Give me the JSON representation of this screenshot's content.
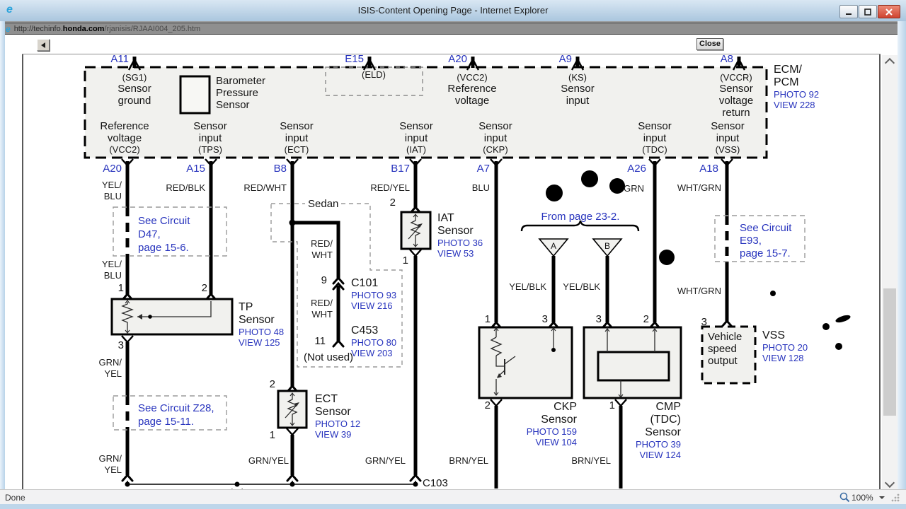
{
  "window": {
    "title": "ISIS-Content Opening Page - Internet Explorer",
    "url_prefix": "http://techinfo.",
    "url_domain": "honda.com",
    "url_path": "/rjanisis/RJAAI004_205.htm",
    "close_button": "Close",
    "status": "Done",
    "zoom_level": "100%"
  },
  "colors": {
    "link_blue": "#2733bd",
    "wire_black": "#000000",
    "titlebar_blue": "#c8dbec",
    "close_red": "#d9482f"
  },
  "ecm": {
    "name": [
      "ECM/",
      "PCM"
    ],
    "photo": "PHOTO 92",
    "view": "VIEW 228",
    "eld": "(ELD)",
    "top_pins": [
      "A11",
      "E15",
      "A20",
      "A9",
      "A8"
    ],
    "bottom_pins": [
      "A20",
      "A15",
      "B8",
      "B17",
      "A7",
      "A26",
      "A18"
    ],
    "cells": {
      "sg1": [
        "(SG1)",
        "Sensor",
        "ground"
      ],
      "baro": [
        "Barometer",
        "Pressure",
        "Sensor"
      ],
      "vcc2_top": [
        "(VCC2)",
        "Reference",
        "voltage"
      ],
      "ks": [
        "(KS)",
        "Sensor",
        "input"
      ],
      "vccr": [
        "(VCCR)",
        "Sensor",
        "voltage",
        "return"
      ],
      "refv": [
        "Reference",
        "voltage",
        "(VCC2)"
      ],
      "tps": [
        "Sensor",
        "input",
        "(TPS)"
      ],
      "ect": [
        "Sensor",
        "input",
        "(ECT)"
      ],
      "iat": [
        "Sensor",
        "input",
        "(IAT)"
      ],
      "ckp": [
        "Sensor",
        "input",
        "(CKP)"
      ],
      "tdc": [
        "Sensor",
        "input",
        "(TDC)"
      ],
      "vss": [
        "Sensor",
        "input",
        "(VSS)"
      ]
    }
  },
  "wire_labels": {
    "yel_blu": [
      "YEL/",
      "BLU"
    ],
    "red_blk": "RED/BLK",
    "red_wht": "RED/WHT",
    "red_yel": "RED/YEL",
    "blu": "BLU",
    "grn": "GRN",
    "wht_grn": "WHT/GRN",
    "grn_yel_stacked": [
      "GRN/",
      "YEL"
    ],
    "grn_yel": "GRN/YEL",
    "brn_yel": "BRN/YEL",
    "yel_blk": "YEL/BLK",
    "red_wht_stacked": [
      "RED/",
      "WHT"
    ]
  },
  "refs": {
    "d47": [
      "See Circuit",
      "D47,",
      "page 15-6."
    ],
    "z28": [
      "See Circuit Z28,",
      "page 15-11."
    ],
    "e93": [
      "See Circuit",
      "E93,",
      "page 15-7."
    ],
    "from_page": "From page 23-2.",
    "sedan": "Sedan",
    "not_used": "(Not used)",
    "c103": "C103"
  },
  "connectors": {
    "c101": {
      "pin": "9",
      "name": "C101",
      "photo": "PHOTO 93",
      "view": "VIEW 216"
    },
    "c453": {
      "pin": "11",
      "name": "C453",
      "photo": "PHOTO 80",
      "view": "VIEW 203"
    }
  },
  "sensors": {
    "tp": {
      "name": [
        "TP",
        "Sensor"
      ],
      "photo": "PHOTO 48",
      "view": "VIEW 125",
      "pin1": "1",
      "pin2": "2",
      "pin3": "3"
    },
    "ect": {
      "name": [
        "ECT",
        "Sensor"
      ],
      "photo": "PHOTO 12",
      "view": "VIEW 39",
      "pin2": "2",
      "pin1": "1"
    },
    "iat": {
      "name": [
        "IAT",
        "Sensor"
      ],
      "photo": "PHOTO 36",
      "view": "VIEW 53",
      "pin2": "2",
      "pin1": "1"
    },
    "ckp": {
      "name": [
        "CKP",
        "Sensor"
      ],
      "photo": "PHOTO 159",
      "view": "VIEW 104",
      "pin1": "1",
      "pin3": "3",
      "pin2": "2"
    },
    "cmp": {
      "name": [
        "CMP",
        "(TDC)",
        "Sensor"
      ],
      "photo": "PHOTO 39",
      "view": "VIEW 124",
      "pin3": "3",
      "pin2": "2",
      "pin1": "1"
    },
    "vss": {
      "name": "VSS",
      "photo": "PHOTO 20",
      "view": "VIEW 128",
      "pin3": "3",
      "box": [
        "Vehicle",
        "speed",
        "output"
      ]
    }
  },
  "triangles": {
    "a": "A",
    "b": "B"
  }
}
